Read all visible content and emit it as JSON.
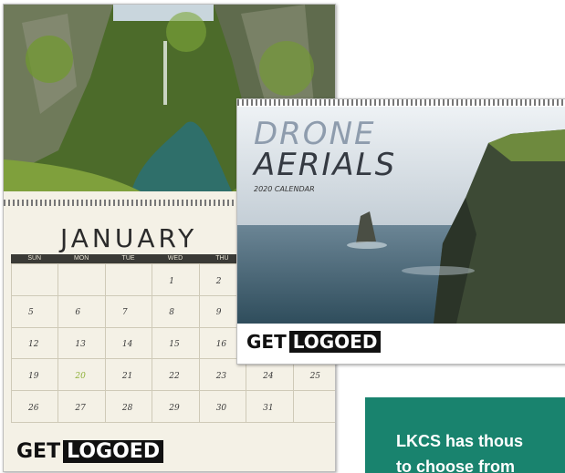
{
  "back_calendar": {
    "month": "JANUARY",
    "weekdays": [
      "SUN",
      "MON",
      "TUE",
      "WED",
      "THU",
      "",
      ""
    ],
    "days": [
      "",
      "",
      "",
      "1",
      "2",
      "",
      "",
      "5",
      "6",
      "7",
      "8",
      "9",
      "",
      "",
      "12",
      "13",
      "14",
      "15",
      "16",
      "",
      "",
      "19",
      "20",
      "21",
      "22",
      "23",
      "24",
      "25",
      "26",
      "27",
      "28",
      "29",
      "30",
      "31",
      ""
    ],
    "highlight_day": "20",
    "brand_get": "GET",
    "brand_logo": "LOGOED"
  },
  "front_calendar": {
    "title_line1": "DRONE",
    "title_line2": "AERIALS",
    "subtitle": "2020 CALENDAR",
    "brand_get": "GET",
    "brand_logo": "LOGOED"
  },
  "cta": {
    "text": "LKCS has thous",
    "text_line2": "to choose from",
    "color": "#19836e"
  }
}
